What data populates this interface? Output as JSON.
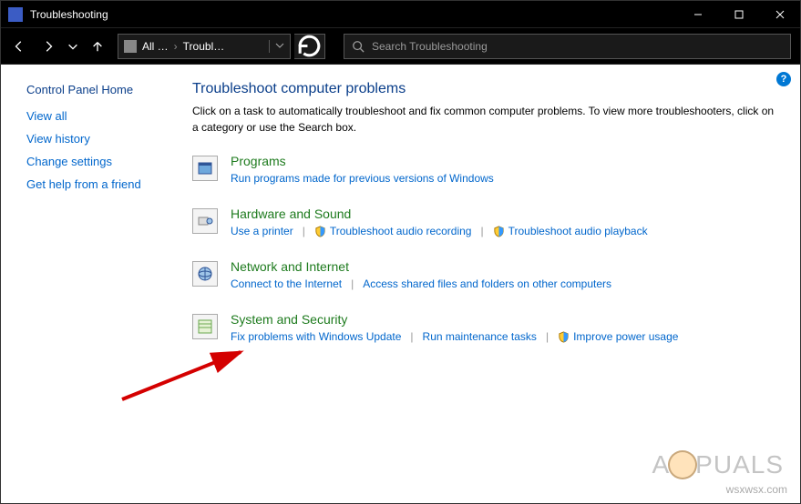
{
  "window": {
    "title": "Troubleshooting"
  },
  "breadcrumb": {
    "root": "All …",
    "current": "Troubl…"
  },
  "search": {
    "placeholder": "Search Troubleshooting"
  },
  "sidepanel": {
    "home": "Control Panel Home",
    "items": [
      "View all",
      "View history",
      "Change settings",
      "Get help from a friend"
    ]
  },
  "main": {
    "title": "Troubleshoot computer problems",
    "description": "Click on a task to automatically troubleshoot and fix common computer problems. To view more troubleshooters, click on a category or use the Search box.",
    "categories": [
      {
        "name": "Programs",
        "links": [
          {
            "label": "Run programs made for previous versions of Windows",
            "shield": false
          }
        ]
      },
      {
        "name": "Hardware and Sound",
        "links": [
          {
            "label": "Use a printer",
            "shield": false
          },
          {
            "label": "Troubleshoot audio recording",
            "shield": true
          },
          {
            "label": "Troubleshoot audio playback",
            "shield": true
          }
        ]
      },
      {
        "name": "Network and Internet",
        "links": [
          {
            "label": "Connect to the Internet",
            "shield": false
          },
          {
            "label": "Access shared files and folders on other computers",
            "shield": false
          }
        ]
      },
      {
        "name": "System and Security",
        "links": [
          {
            "label": "Fix problems with Windows Update",
            "shield": false
          },
          {
            "label": "Run maintenance tasks",
            "shield": false
          },
          {
            "label": "Improve power usage",
            "shield": true
          }
        ]
      }
    ]
  },
  "help_badge": "?",
  "watermark": {
    "brand_left": "A",
    "brand_right": "PUALS",
    "url": "wsxwsx.com"
  }
}
